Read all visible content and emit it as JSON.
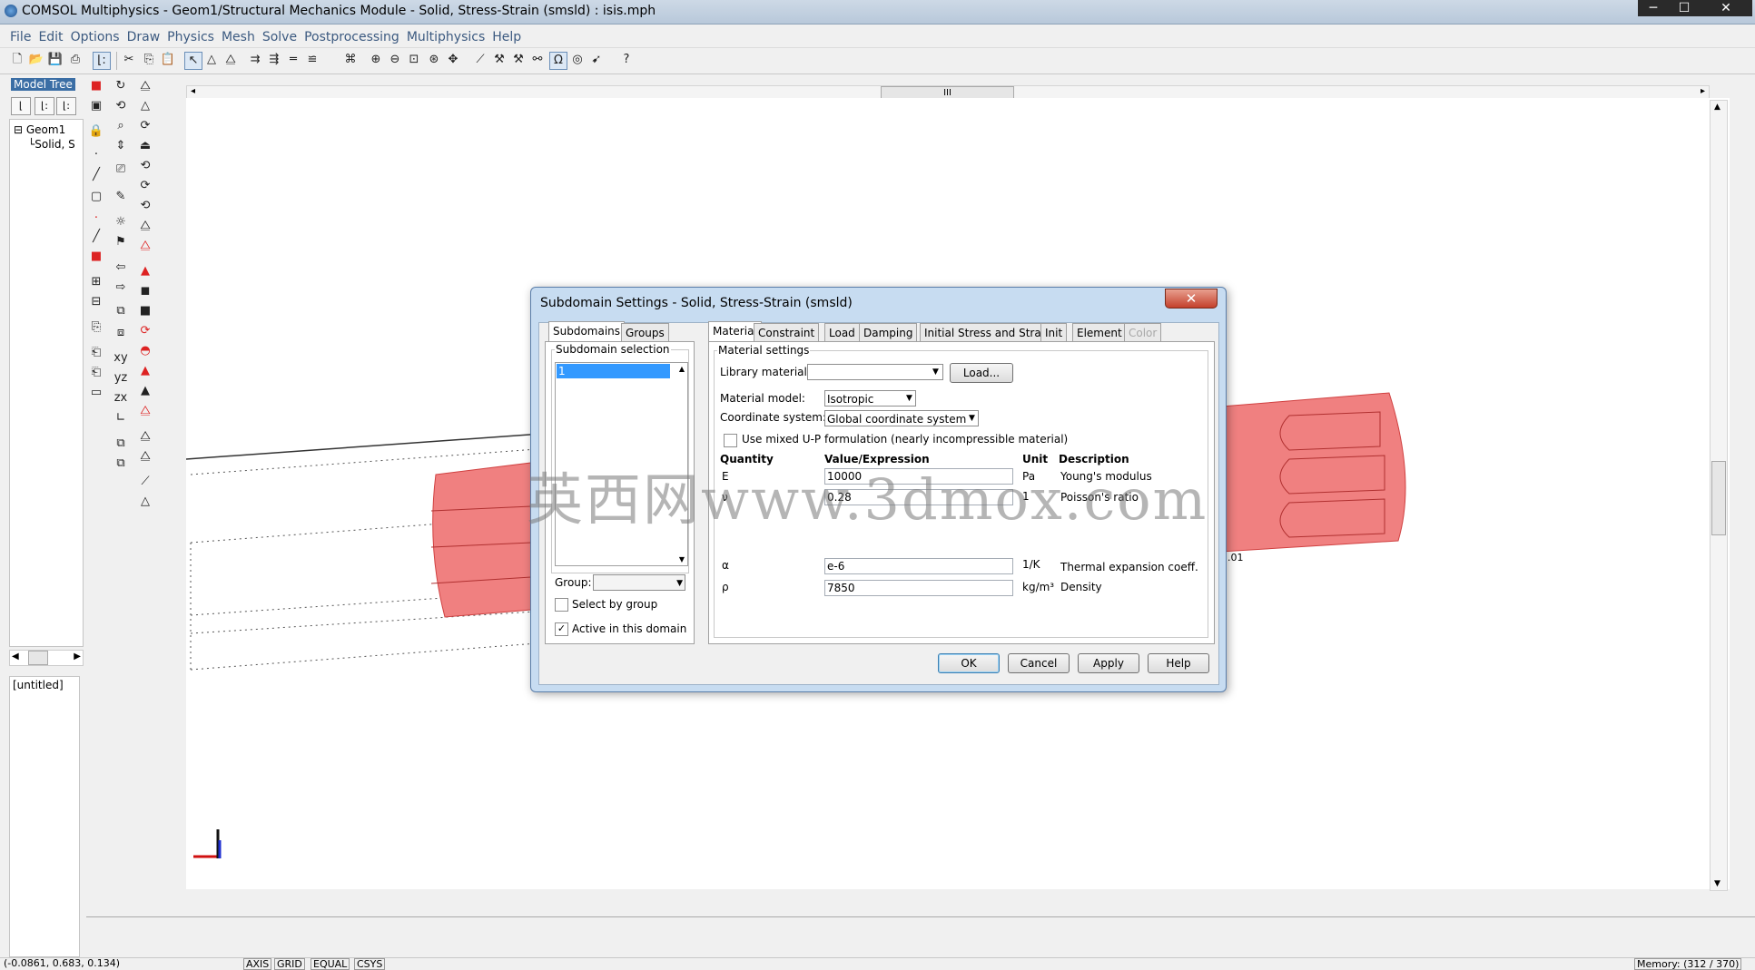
{
  "window": {
    "title": "COMSOL Multiphysics - Geom1/Structural Mechanics Module - Solid, Stress-Strain (smsld) : isis.mph",
    "minimize": "─",
    "maximize": "☐",
    "close": "✕"
  },
  "menu": [
    "File",
    "Edit",
    "Options",
    "Draw",
    "Physics",
    "Mesh",
    "Solve",
    "Postprocessing",
    "Multiphysics",
    "Help"
  ],
  "model_tree": {
    "label": "Model Tree",
    "buttons": [
      "⌊",
      "⌊:",
      "⌊:"
    ],
    "nodes": [
      "Geom1",
      "Solid, S"
    ],
    "bottom_label": "[untitled]"
  },
  "canvas": {
    "scroll_thumb": "III",
    "axis_label": ".01"
  },
  "watermark": "英西网www.3dmox.com",
  "status": {
    "coords": "(-0.0861, 0.683, 0.134)",
    "toggles": [
      "AXIS",
      "GRID",
      "EQUAL",
      "CSYS"
    ],
    "memory": "Memory: (312 / 370)"
  },
  "dialog": {
    "title": "Subdomain Settings - Solid, Stress-Strain (smsld)",
    "close": "✕",
    "left_tabs": [
      "Subdomains",
      "Groups"
    ],
    "subdomain_selection_title": "Subdomain selection",
    "subdomain_items": [
      "1"
    ],
    "group_label": "Group:",
    "select_by_group": "Select by group",
    "active_in_domain": "Active in this domain",
    "right_tabs": [
      "Material",
      "Constraint",
      "Load",
      "Damping",
      "Initial Stress and Strain",
      "Init",
      "Element",
      "Color"
    ],
    "material_settings_title": "Material settings",
    "library_material_label": "Library material:",
    "library_material_value": "",
    "load_button": "Load...",
    "material_model_label": "Material model:",
    "material_model_value": "Isotropic",
    "coord_system_label": "Coordinate system:",
    "coord_system_value": "Global coordinate system",
    "mixed_up_label": "Use mixed U-P formulation (nearly incompressible material)",
    "headers": {
      "quantity": "Quantity",
      "value": "Value/Expression",
      "unit": "Unit",
      "description": "Description"
    },
    "rows": [
      {
        "symbol": "E",
        "value": "10000",
        "unit": "Pa",
        "description": "Young's modulus"
      },
      {
        "symbol": "ν",
        "value": "0.28",
        "unit": "1",
        "description": "Poisson's ratio"
      },
      {
        "symbol": "α",
        "value": "e-6",
        "unit": "1/K",
        "description": "Thermal expansion coeff."
      },
      {
        "symbol": "ρ",
        "value": "7850",
        "unit": "kg/m³",
        "description": "Density"
      }
    ],
    "buttons": {
      "ok": "OK",
      "cancel": "Cancel",
      "apply": "Apply",
      "help": "Help"
    }
  },
  "colors": {
    "shape_fill": "#f08080",
    "shape_stroke": "#d04040",
    "selection_blue": "#3399ff"
  }
}
